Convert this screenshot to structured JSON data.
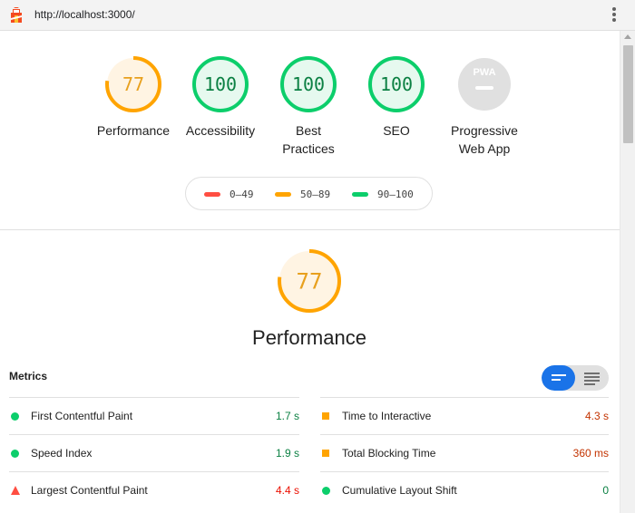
{
  "browser": {
    "url": "http://localhost:3000/",
    "logo_icon": "lighthouse-icon",
    "menu_icon": "kebab-menu-icon"
  },
  "colors": {
    "pass": "#0cce6b",
    "average": "#ffa400",
    "fail": "#ff4e42",
    "pwa_gray": "#e0e0e0"
  },
  "categories": [
    {
      "score": "77",
      "label": "Performance",
      "status": "average",
      "value": 0.77
    },
    {
      "score": "100",
      "label": "Accessibility",
      "status": "pass",
      "value": 1.0
    },
    {
      "score": "100",
      "label": "Best\nPractices",
      "status": "pass",
      "value": 1.0
    },
    {
      "score": "100",
      "label": "SEO",
      "status": "pass",
      "value": 1.0
    },
    {
      "score": "PWA",
      "label": "Progressive\nWeb App",
      "status": "na",
      "value": 0
    }
  ],
  "legend": [
    {
      "range": "0–49",
      "status": "fail"
    },
    {
      "range": "50–89",
      "status": "average"
    },
    {
      "range": "90–100",
      "status": "pass"
    }
  ],
  "performance": {
    "score": "77",
    "value": 0.77,
    "title": "Performance"
  },
  "metrics": {
    "heading": "Metrics",
    "view_toggle": {
      "selected": "compact",
      "icons": [
        "compact-view-icon",
        "expanded-view-icon"
      ]
    },
    "left": [
      {
        "name": "First Contentful Paint",
        "value": "1.7 s",
        "status": "pass"
      },
      {
        "name": "Speed Index",
        "value": "1.9 s",
        "status": "pass"
      },
      {
        "name": "Largest Contentful Paint",
        "value": "4.4 s",
        "status": "fail"
      }
    ],
    "right": [
      {
        "name": "Time to Interactive",
        "value": "4.3 s",
        "status": "average"
      },
      {
        "name": "Total Blocking Time",
        "value": "360 ms",
        "status": "average"
      },
      {
        "name": "Cumulative Layout Shift",
        "value": "0",
        "status": "pass"
      }
    ]
  }
}
